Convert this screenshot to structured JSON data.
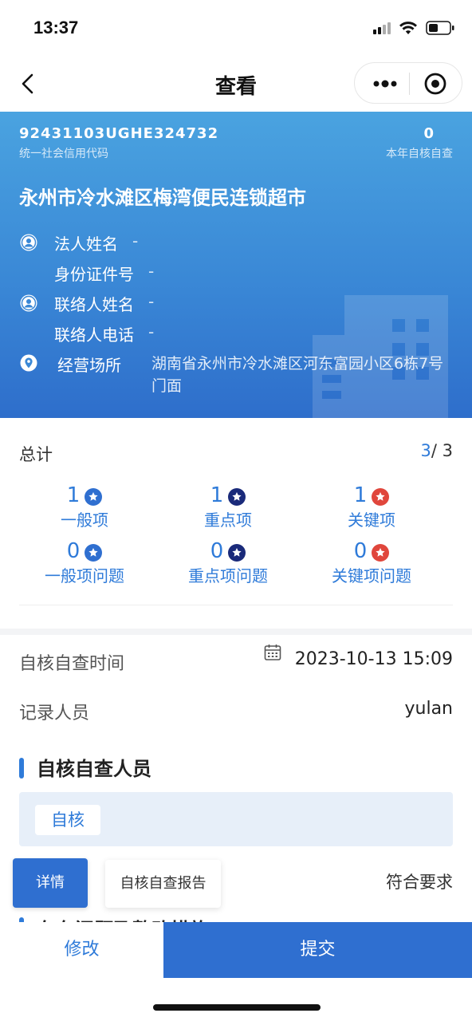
{
  "status_bar": {
    "time": "13:37"
  },
  "nav": {
    "title": "查看"
  },
  "header": {
    "credit_code": "92431103UGHE324732",
    "credit_code_label": "统一社会信用代码",
    "check_count": "0",
    "check_count_label": "本年自核自查",
    "company_name": "永州市冷水滩区梅湾便民连锁超市",
    "legal_name_label": "法人姓名",
    "legal_name_value": "-",
    "id_label": "身份证件号",
    "id_value": "-",
    "contact_name_label": "联络人姓名",
    "contact_name_value": "-",
    "contact_phone_label": "联络人电话",
    "contact_phone_value": "-",
    "address_label": "经营场所",
    "address_value": "湖南省永州市冷水滩区河东富园小区6栋7号门面"
  },
  "totals": {
    "label": "总计",
    "current": "3",
    "total": "/ 3",
    "stats": [
      {
        "num": "1",
        "label": "一般项",
        "star_color": "#2f6fd0"
      },
      {
        "num": "1",
        "label": "重点项",
        "star_color": "#1a2a7a"
      },
      {
        "num": "1",
        "label": "关键项",
        "star_color": "#e0463c"
      },
      {
        "num": "0",
        "label": "一般项问题",
        "star_color": "#2f6fd0"
      },
      {
        "num": "0",
        "label": "重点项问题",
        "star_color": "#1a2a7a"
      },
      {
        "num": "0",
        "label": "关键项问题",
        "star_color": "#e0463c"
      }
    ]
  },
  "details": {
    "time_label": "自核自查时间",
    "time_value": "2023-10-13 15:09",
    "recorder_label": "记录人员",
    "recorder_value": "yulan",
    "members_title": "自核自查人员",
    "member_tag": "自核",
    "detail_button": "详情",
    "report_button": "自核自查报告",
    "conform_text": "符合要求",
    "next_section_title": "存在问题及整改措施"
  },
  "bottom": {
    "modify": "修改",
    "submit": "提交"
  },
  "colors": {
    "primary": "#2f7bd9",
    "header_gradient_top": "#4aa3e0",
    "header_gradient_bottom": "#2e6ecb"
  }
}
